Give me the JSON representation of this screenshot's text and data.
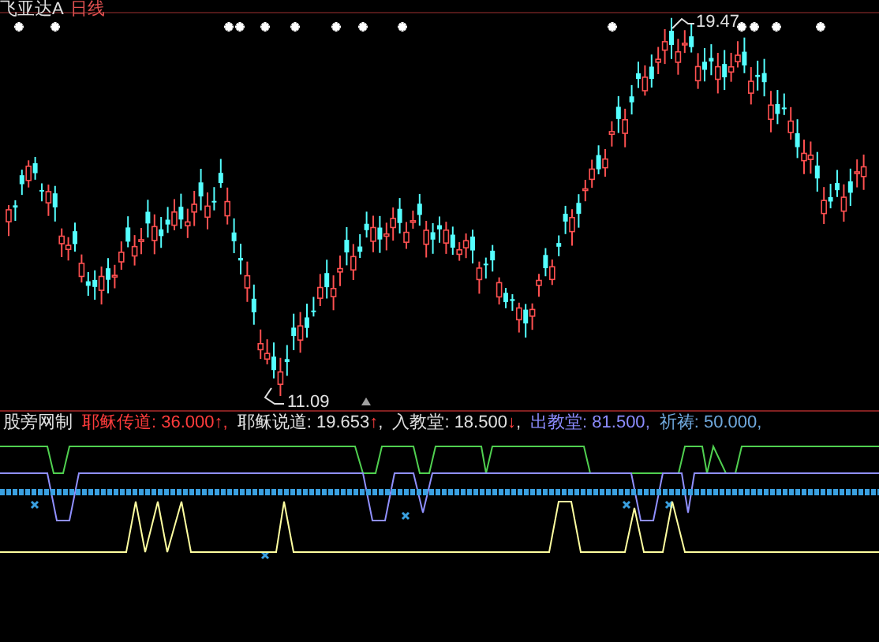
{
  "header": {
    "stock": "飞亚达A",
    "period": "日线"
  },
  "price_chart": {
    "high_label": "19.47",
    "low_label": "11.09"
  },
  "indicator": {
    "name": "股旁网制",
    "values": [
      {
        "label": "耶稣传道:",
        "value": "36.000",
        "arrow": "↑",
        "suffix": ",",
        "color": "#ff3c3c"
      },
      {
        "label": "耶稣说道:",
        "value": "19.653",
        "arrow": "↑",
        "suffix": ",",
        "color": "#e0e0e0"
      },
      {
        "label": "入教堂:",
        "value": "18.500",
        "arrow": "↓",
        "suffix": ",",
        "color": "#e0e0e0"
      },
      {
        "label": "出教堂:",
        "value": "81.500",
        "suffix": ",",
        "color": "#8c8cff"
      },
      {
        "label": "祈祷:",
        "value": "50.000",
        "suffix": ",",
        "color": "#6fa8dc"
      }
    ]
  }
}
